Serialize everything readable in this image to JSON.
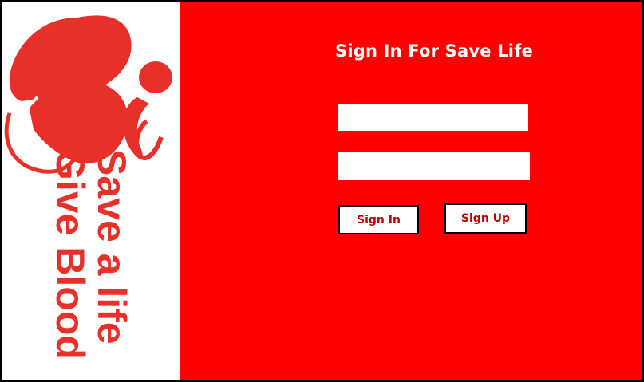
{
  "page": {
    "title": "Sign In For Save Life"
  },
  "logo": {
    "line1": "Save a life",
    "line2": "Give Blood",
    "color": "#e8302a"
  },
  "form": {
    "username": {
      "value": "",
      "placeholder": ""
    },
    "password": {
      "value": "",
      "placeholder": ""
    }
  },
  "buttons": {
    "signin_label": "Sign In",
    "signup_label": "Sign Up"
  },
  "colors": {
    "panel_background": "#ff0000",
    "title_text": "#ffffff",
    "button_text": "#c00000",
    "button_border": "#000000"
  }
}
